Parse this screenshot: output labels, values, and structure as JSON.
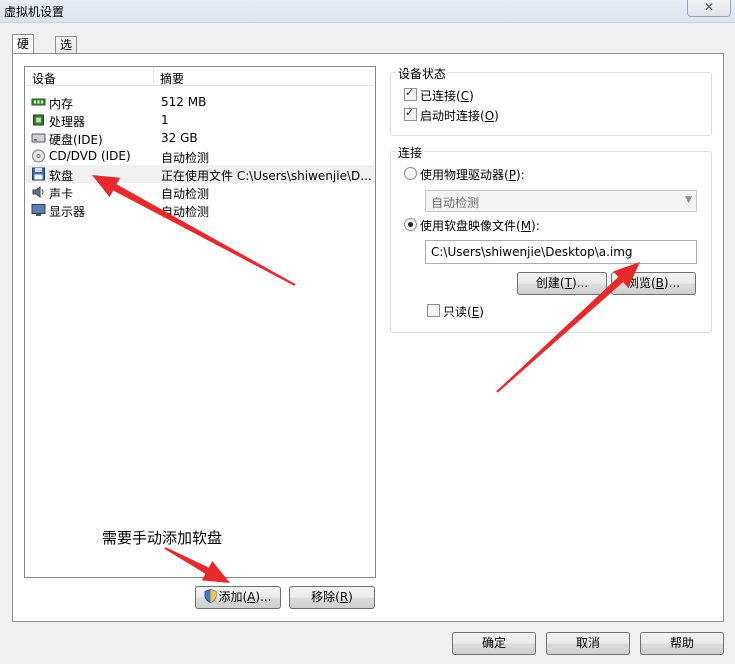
{
  "window": {
    "title": "虚拟机设置",
    "close_glyph": "✕"
  },
  "tabs": [
    {
      "label": "硬件"
    },
    {
      "label": "选项"
    }
  ],
  "device_list": {
    "headers": {
      "device": "设备",
      "summary": "摘要"
    },
    "rows": [
      {
        "name": "内存",
        "summary": "512 MB",
        "icon": "memory-icon"
      },
      {
        "name": "处理器",
        "summary": "1",
        "icon": "processor-icon"
      },
      {
        "name": "硬盘(IDE)",
        "summary": "32 GB",
        "icon": "hard-disk-icon"
      },
      {
        "name": "CD/DVD (IDE)",
        "summary": "自动检测",
        "icon": "cd-dvd-icon"
      },
      {
        "name": "软盘",
        "summary": "正在使用文件 C:\\Users\\shiwenjie\\D...",
        "icon": "floppy-icon",
        "selected": true
      },
      {
        "name": "声卡",
        "summary": "自动检测",
        "icon": "sound-card-icon"
      },
      {
        "name": "显示器",
        "summary": "自动检测",
        "icon": "display-icon"
      }
    ]
  },
  "device_status": {
    "title": "设备状态",
    "connected": {
      "label": "已连接(",
      "key": "C",
      "suffix": ")",
      "checked": true
    },
    "connect_at_power_on": {
      "label": "启动时连接(",
      "key": "O",
      "suffix": ")",
      "checked": true
    }
  },
  "connection": {
    "title": "连接",
    "physical_drive": {
      "label": "使用物理驱动器(",
      "key": "P",
      "suffix": "):",
      "selected": false
    },
    "physical_drive_value": "自动检测",
    "image_file": {
      "label": "使用软盘映像文件(",
      "key": "M",
      "suffix": "):",
      "selected": true
    },
    "image_path": "C:\\Users\\shiwenjie\\Desktop\\a.img",
    "create_button": {
      "label": "创建(",
      "key": "T",
      "suffix": ")..."
    },
    "browse_button": {
      "label": "浏览(",
      "key": "B",
      "suffix": ")..."
    },
    "read_only": {
      "label": "只读(",
      "key": "E",
      "suffix": ")",
      "checked": false
    }
  },
  "list_buttons": {
    "add": {
      "label": "添加(",
      "key": "A",
      "suffix": ")..."
    },
    "remove": {
      "label": "移除(",
      "key": "R",
      "suffix": ")"
    }
  },
  "annotation": {
    "text": "需要手动添加软盘",
    "arrow_color": "#e8282a"
  },
  "footer": {
    "ok": "确定",
    "cancel": "取消",
    "help": "帮助"
  }
}
